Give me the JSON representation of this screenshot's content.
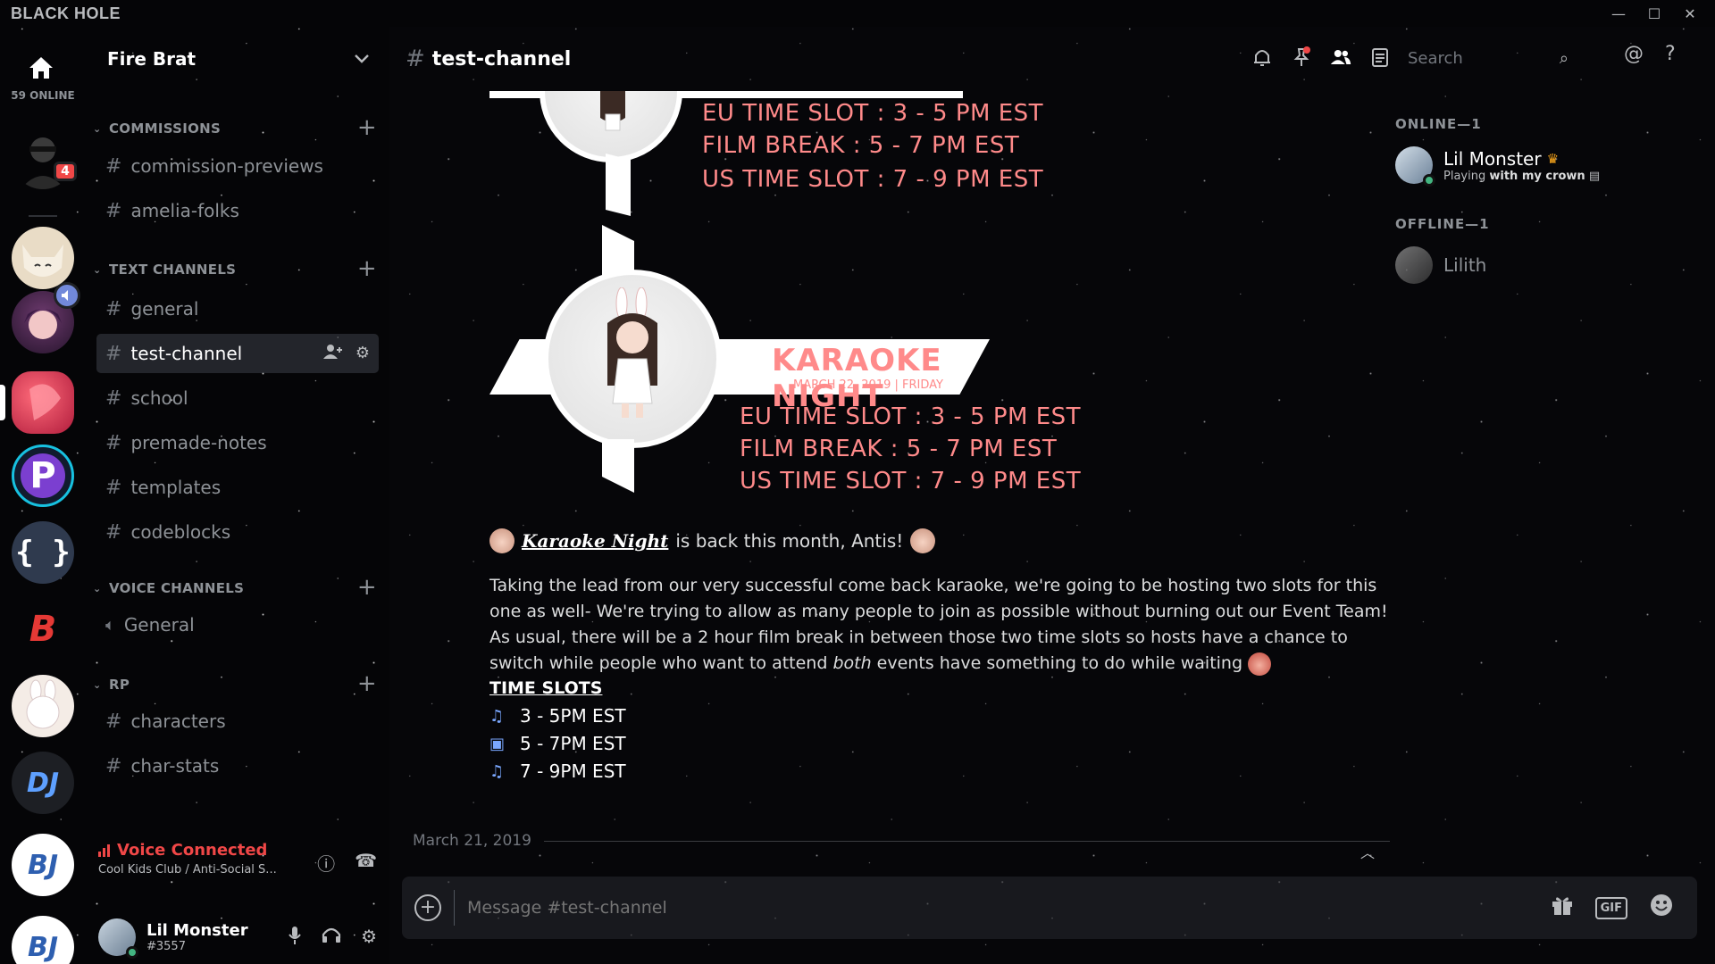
{
  "window": {
    "app_title": "BLACK HOLE",
    "controls": [
      "—",
      "☐",
      "✕"
    ]
  },
  "servers": {
    "online_count": "59 ONLINE",
    "mention_count": "4",
    "icons": [
      "home-icon",
      "user-avatar",
      "cat-server",
      "anime-server",
      "red-art-server",
      "p-server",
      "braces-server",
      "b-server",
      "bunny-server",
      "dj-server",
      "bj-server",
      "bj2-server"
    ],
    "braces_glyph": "{ }",
    "p_glyph": "P",
    "b_glyph": "B",
    "dj_glyph": "DJ",
    "bj_glyph": "BJ"
  },
  "sidebar": {
    "guild_name": "Fire Brat",
    "categories": [
      {
        "label": "COMMISSIONS"
      },
      {
        "label": "TEXT CHANNELS"
      },
      {
        "label": "VOICE CHANNELS"
      },
      {
        "label": "RP"
      }
    ],
    "channels": {
      "commission_previews": "commission-previews",
      "amelia_folks": "amelia-folks",
      "general": "general",
      "test_channel": "test-channel",
      "school": "school",
      "premade_notes": "premade-notes",
      "templates": "templates",
      "codeblocks": "codeblocks",
      "voice_general": "General",
      "characters": "characters",
      "char_stats": "char-stats"
    },
    "voice": {
      "status": "Voice Connected",
      "server": "Cool Kids Club / Anti-Social S..."
    },
    "user": {
      "name": "Lil Monster",
      "tag": "#3557"
    }
  },
  "header": {
    "channel_name": "test-channel",
    "search_placeholder": "Search"
  },
  "message": {
    "banner_top": {
      "eu": "EU TIME SLOT : 3 - 5 PM EST",
      "film": "FILM BREAK : 5 - 7 PM EST",
      "us": "US TIME SLOT : 7 - 9 PM EST"
    },
    "banner_main": {
      "title": "KARAOKE NIGHT",
      "date": "MARCH 22, 2019 | FRIDAY",
      "eu": "EU TIME SLOT : 3 - 5 PM EST",
      "film": "FILM BREAK : 5 - 7 PM EST",
      "us": "US TIME SLOT : 7 - 9 PM EST"
    },
    "headline_link": "Karaoke Night",
    "headline_rest": "is back this month, Antis!",
    "para_part1": "Taking the lead from our very successful come back karaoke, we're going to be hosting two slots for this one as well- We're trying to allow as many people to join as possible without burning out our Event Team! As usual, there will be a 2 hour film break in between those two time slots so hosts have a chance to switch while people who want to attend ",
    "para_em": "both",
    "para_part2": " events have something to do while waiting",
    "time_slots_title": "TIME SLOTS",
    "slots": [
      "3 - 5PM EST",
      "5 - 7PM EST",
      "7 - 9PM EST"
    ],
    "date_divider": "March 21, 2019"
  },
  "composer": {
    "placeholder": "Message #test-channel",
    "gif_label": "GIF"
  },
  "members": {
    "online_header": "ONLINE—1",
    "offline_header": "OFFLINE—1",
    "online": [
      {
        "name": "Lil Monster",
        "activity_prefix": "Playing",
        "activity": "with my crown"
      }
    ],
    "offline": [
      {
        "name": "Lilith"
      }
    ]
  }
}
